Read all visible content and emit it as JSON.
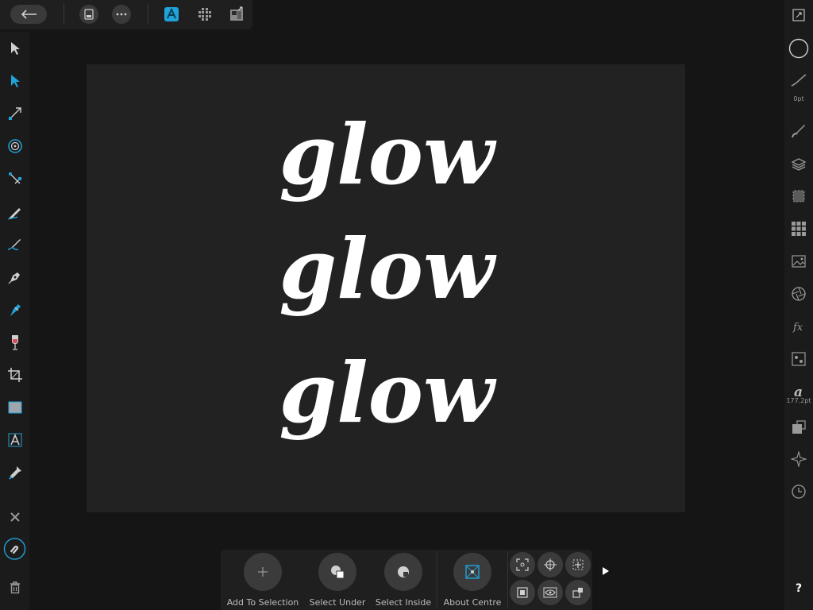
{
  "canvas": {
    "lines": [
      "glow",
      "glow",
      "glow"
    ],
    "background_color": "#222222",
    "text_color": "#ffffff"
  },
  "toolbar_top": {
    "back_icon": "back-arrow-icon",
    "icons": [
      "document-icon",
      "more-icon",
      "designer-persona-icon",
      "pixel-persona-icon",
      "export-persona-icon"
    ]
  },
  "tools_left": [
    "move-tool-icon",
    "node-tool-icon",
    "transform-tool-icon",
    "corner-tool-icon",
    "point-transform-icon",
    "pencil-tool-icon",
    "vector-brush-icon",
    "pen-tool-icon",
    "fill-tool-icon",
    "transparency-tool-icon",
    "crop-tool-icon",
    "rectangle-tool-icon",
    "artistic-text-icon",
    "color-picker-icon",
    "close-icon",
    "snapping-icon",
    "delete-icon"
  ],
  "studio": {
    "stroke_width": "0pt",
    "font_size": "177.2pt",
    "help": "?"
  },
  "context_toolbar": {
    "add_to_selection": "Add To Selection",
    "select_under": "Select Under",
    "select_inside": "Select Inside",
    "about_centre": "About Centre"
  },
  "colors": {
    "accent": "#1fa3d9",
    "panel": "#1f1f1f"
  }
}
